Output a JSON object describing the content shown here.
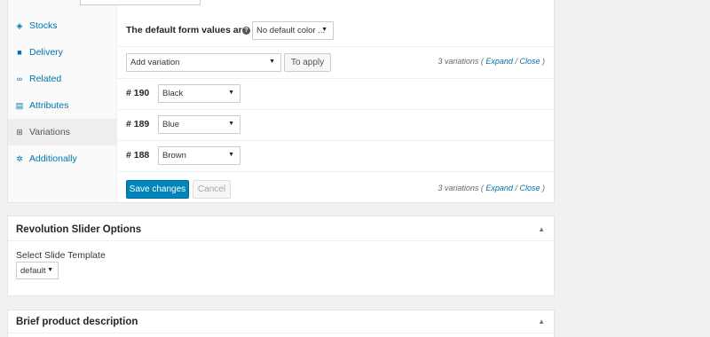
{
  "tabs": [
    {
      "label": "Stocks",
      "icon": "tag-icon"
    },
    {
      "label": "Delivery",
      "icon": "truck-icon"
    },
    {
      "label": "Related",
      "icon": "link-icon"
    },
    {
      "label": "Attributes",
      "icon": "list-icon"
    },
    {
      "label": "Variations",
      "icon": "grid-icon"
    },
    {
      "label": "Additionally",
      "icon": "gear-icon"
    }
  ],
  "defaults": {
    "label": "The default form values are:",
    "select_value": "No default color ...",
    "help": "?"
  },
  "toolbar": {
    "add_select": "Add variation",
    "apply_label": "To apply"
  },
  "counter": {
    "text": "3 variations",
    "open_paren": "(",
    "expand": "Expand",
    "sep": "/",
    "close": "Close",
    "close_paren": ")"
  },
  "variations": [
    {
      "num": "# 190",
      "value": "Black"
    },
    {
      "num": "# 189",
      "value": "Blue"
    },
    {
      "num": "# 188",
      "value": "Brown"
    }
  ],
  "actions": {
    "save_label": "Save changes",
    "cancel_label": "Cancel"
  },
  "slider_box": {
    "title": "Revolution Slider Options",
    "field_label": "Select Slide Template",
    "select_value": "default"
  },
  "brief_box": {
    "title": "Brief product description"
  },
  "arrow_glyph": "▼",
  "toggle_glyph": "▲",
  "colors": {
    "link": "#0073aa",
    "primary": "#0085ba"
  }
}
